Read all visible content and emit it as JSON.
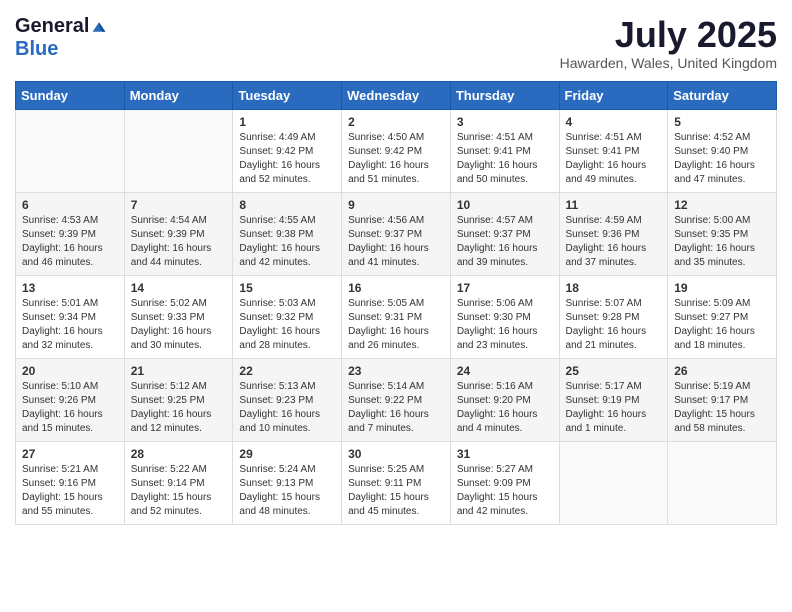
{
  "header": {
    "logo_general": "General",
    "logo_blue": "Blue",
    "month_title": "July 2025",
    "location": "Hawarden, Wales, United Kingdom"
  },
  "weekdays": [
    "Sunday",
    "Monday",
    "Tuesday",
    "Wednesday",
    "Thursday",
    "Friday",
    "Saturday"
  ],
  "weeks": [
    [
      {
        "day": "",
        "info": ""
      },
      {
        "day": "",
        "info": ""
      },
      {
        "day": "1",
        "info": "Sunrise: 4:49 AM\nSunset: 9:42 PM\nDaylight: 16 hours and 52 minutes."
      },
      {
        "day": "2",
        "info": "Sunrise: 4:50 AM\nSunset: 9:42 PM\nDaylight: 16 hours and 51 minutes."
      },
      {
        "day": "3",
        "info": "Sunrise: 4:51 AM\nSunset: 9:41 PM\nDaylight: 16 hours and 50 minutes."
      },
      {
        "day": "4",
        "info": "Sunrise: 4:51 AM\nSunset: 9:41 PM\nDaylight: 16 hours and 49 minutes."
      },
      {
        "day": "5",
        "info": "Sunrise: 4:52 AM\nSunset: 9:40 PM\nDaylight: 16 hours and 47 minutes."
      }
    ],
    [
      {
        "day": "6",
        "info": "Sunrise: 4:53 AM\nSunset: 9:39 PM\nDaylight: 16 hours and 46 minutes."
      },
      {
        "day": "7",
        "info": "Sunrise: 4:54 AM\nSunset: 9:39 PM\nDaylight: 16 hours and 44 minutes."
      },
      {
        "day": "8",
        "info": "Sunrise: 4:55 AM\nSunset: 9:38 PM\nDaylight: 16 hours and 42 minutes."
      },
      {
        "day": "9",
        "info": "Sunrise: 4:56 AM\nSunset: 9:37 PM\nDaylight: 16 hours and 41 minutes."
      },
      {
        "day": "10",
        "info": "Sunrise: 4:57 AM\nSunset: 9:37 PM\nDaylight: 16 hours and 39 minutes."
      },
      {
        "day": "11",
        "info": "Sunrise: 4:59 AM\nSunset: 9:36 PM\nDaylight: 16 hours and 37 minutes."
      },
      {
        "day": "12",
        "info": "Sunrise: 5:00 AM\nSunset: 9:35 PM\nDaylight: 16 hours and 35 minutes."
      }
    ],
    [
      {
        "day": "13",
        "info": "Sunrise: 5:01 AM\nSunset: 9:34 PM\nDaylight: 16 hours and 32 minutes."
      },
      {
        "day": "14",
        "info": "Sunrise: 5:02 AM\nSunset: 9:33 PM\nDaylight: 16 hours and 30 minutes."
      },
      {
        "day": "15",
        "info": "Sunrise: 5:03 AM\nSunset: 9:32 PM\nDaylight: 16 hours and 28 minutes."
      },
      {
        "day": "16",
        "info": "Sunrise: 5:05 AM\nSunset: 9:31 PM\nDaylight: 16 hours and 26 minutes."
      },
      {
        "day": "17",
        "info": "Sunrise: 5:06 AM\nSunset: 9:30 PM\nDaylight: 16 hours and 23 minutes."
      },
      {
        "day": "18",
        "info": "Sunrise: 5:07 AM\nSunset: 9:28 PM\nDaylight: 16 hours and 21 minutes."
      },
      {
        "day": "19",
        "info": "Sunrise: 5:09 AM\nSunset: 9:27 PM\nDaylight: 16 hours and 18 minutes."
      }
    ],
    [
      {
        "day": "20",
        "info": "Sunrise: 5:10 AM\nSunset: 9:26 PM\nDaylight: 16 hours and 15 minutes."
      },
      {
        "day": "21",
        "info": "Sunrise: 5:12 AM\nSunset: 9:25 PM\nDaylight: 16 hours and 12 minutes."
      },
      {
        "day": "22",
        "info": "Sunrise: 5:13 AM\nSunset: 9:23 PM\nDaylight: 16 hours and 10 minutes."
      },
      {
        "day": "23",
        "info": "Sunrise: 5:14 AM\nSunset: 9:22 PM\nDaylight: 16 hours and 7 minutes."
      },
      {
        "day": "24",
        "info": "Sunrise: 5:16 AM\nSunset: 9:20 PM\nDaylight: 16 hours and 4 minutes."
      },
      {
        "day": "25",
        "info": "Sunrise: 5:17 AM\nSunset: 9:19 PM\nDaylight: 16 hours and 1 minute."
      },
      {
        "day": "26",
        "info": "Sunrise: 5:19 AM\nSunset: 9:17 PM\nDaylight: 15 hours and 58 minutes."
      }
    ],
    [
      {
        "day": "27",
        "info": "Sunrise: 5:21 AM\nSunset: 9:16 PM\nDaylight: 15 hours and 55 minutes."
      },
      {
        "day": "28",
        "info": "Sunrise: 5:22 AM\nSunset: 9:14 PM\nDaylight: 15 hours and 52 minutes."
      },
      {
        "day": "29",
        "info": "Sunrise: 5:24 AM\nSunset: 9:13 PM\nDaylight: 15 hours and 48 minutes."
      },
      {
        "day": "30",
        "info": "Sunrise: 5:25 AM\nSunset: 9:11 PM\nDaylight: 15 hours and 45 minutes."
      },
      {
        "day": "31",
        "info": "Sunrise: 5:27 AM\nSunset: 9:09 PM\nDaylight: 15 hours and 42 minutes."
      },
      {
        "day": "",
        "info": ""
      },
      {
        "day": "",
        "info": ""
      }
    ]
  ]
}
